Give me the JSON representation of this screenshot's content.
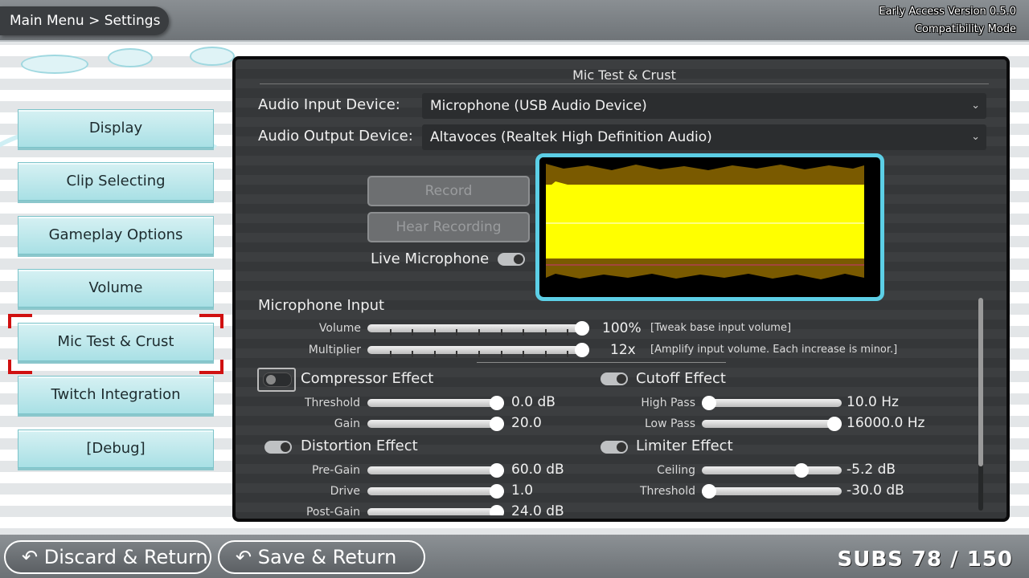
{
  "breadcrumb": "Main Menu > Settings",
  "version": {
    "line1": "Early Access Version 0.5.0",
    "line2": "Compatibility Mode"
  },
  "sidebar": {
    "items": [
      {
        "label": "Display"
      },
      {
        "label": "Clip Selecting"
      },
      {
        "label": "Gameplay Options"
      },
      {
        "label": "Volume"
      },
      {
        "label": "Mic Test & Crust",
        "selected": true
      },
      {
        "label": "Twitch Integration"
      },
      {
        "label": "[Debug]"
      }
    ]
  },
  "panel": {
    "title": "Mic Test & Crust",
    "input_device": {
      "label": "Audio Input Device:",
      "value": "Microphone (USB Audio Device)"
    },
    "output_device": {
      "label": "Audio Output Device:",
      "value": "Altavoces (Realtek High Definition Audio)"
    },
    "record_label": "Record",
    "hear_label": "Hear Recording",
    "live_mic_label": "Live Microphone",
    "live_mic_on": true,
    "mic_input": {
      "title": "Microphone Input",
      "volume": {
        "label": "Volume",
        "value": "100%",
        "level": 1.0,
        "hint": "[Tweak base input volume]"
      },
      "multiplier": {
        "label": "Multiplier",
        "value": "12x",
        "level": 1.0,
        "hint": "[Amplify input volume. Each increase is minor.]"
      }
    },
    "compressor": {
      "title": "Compressor Effect",
      "on": false,
      "threshold": {
        "label": "Threshold",
        "value": "0.0 dB",
        "level": 1.0
      },
      "gain": {
        "label": "Gain",
        "value": "20.0",
        "level": 1.0
      }
    },
    "cutoff": {
      "title": "Cutoff Effect",
      "on": true,
      "high_pass": {
        "label": "High Pass",
        "value": "10.0 Hz",
        "level": 0.0
      },
      "low_pass": {
        "label": "Low Pass",
        "value": "16000.0 Hz",
        "level": 1.0
      }
    },
    "distortion": {
      "title": "Distortion Effect",
      "on": true,
      "pre_gain": {
        "label": "Pre-Gain",
        "value": "60.0 dB",
        "level": 1.0
      },
      "drive": {
        "label": "Drive",
        "value": "1.0",
        "level": 1.0
      },
      "post_gain": {
        "label": "Post-Gain",
        "value": "24.0 dB",
        "level": 1.0
      }
    },
    "limiter": {
      "title": "Limiter Effect",
      "on": true,
      "ceiling": {
        "label": "Ceiling",
        "value": "-5.2 dB",
        "level": 0.74
      },
      "threshold": {
        "label": "Threshold",
        "value": "-30.0 dB",
        "level": 0.0
      }
    }
  },
  "footer": {
    "discard_label": "Discard & Return",
    "save_label": "Save & Return",
    "subs": "SUBS 78 / 150"
  },
  "colors": {
    "accent": "#5ccfe6",
    "selected_frame": "#d01010",
    "waveform": "#ffff00",
    "waveform_shadow": "#7a5a00"
  }
}
